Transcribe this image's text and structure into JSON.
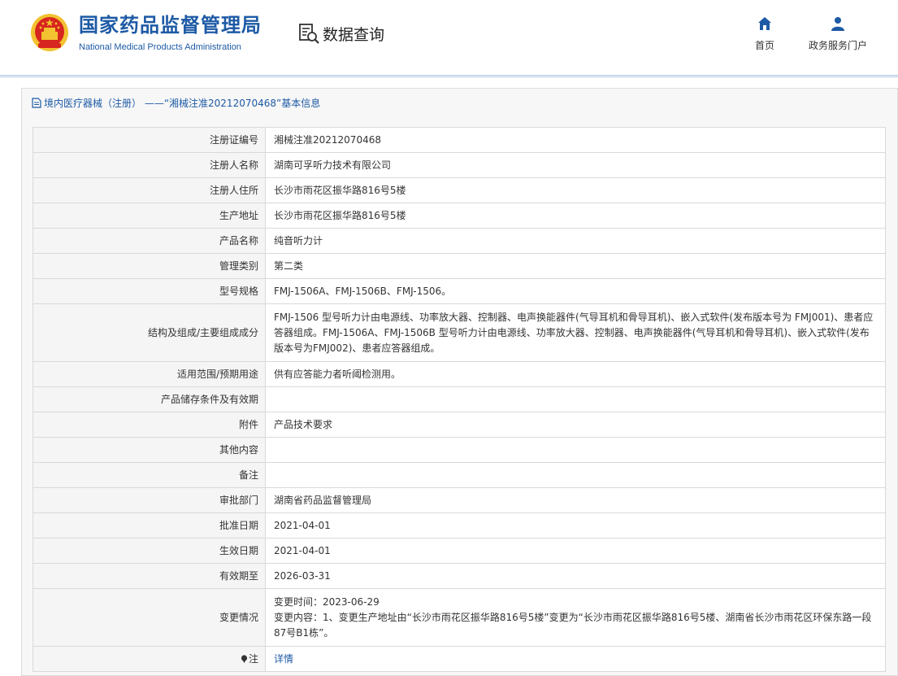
{
  "header": {
    "site_name_cn": "国家药品监督管理局",
    "site_name_en": "National Medical Products Administration",
    "section_title": "数据查询",
    "nav": [
      {
        "label": "首页",
        "icon": "home-icon"
      },
      {
        "label": "政务服务门户",
        "icon": "user-icon"
      }
    ]
  },
  "panel": {
    "title": "境内医疗器械（注册） ——“湘械注准20212070468”基本信息"
  },
  "rows": [
    {
      "key": "注册证编号",
      "value": "湘械注准20212070468"
    },
    {
      "key": "注册人名称",
      "value": "湖南可孚听力技术有限公司"
    },
    {
      "key": "注册人住所",
      "value": "长沙市雨花区振华路816号5楼"
    },
    {
      "key": "生产地址",
      "value": "长沙市雨花区振华路816号5楼"
    },
    {
      "key": "产品名称",
      "value": "纯音听力计"
    },
    {
      "key": "管理类别",
      "value": "第二类"
    },
    {
      "key": "型号规格",
      "value": "FMJ-1506A、FMJ-1506B、FMJ-1506。"
    },
    {
      "key": "结构及组成/主要组成成分",
      "value": "FMJ-1506 型号听力计由电源线、功率放大器、控制器、电声换能器件(气导耳机和骨导耳机)、嵌入式软件(发布版本号为 FMJ001)、患者应答器组成。FMJ-1506A、FMJ-1506B 型号听力计由电源线、功率放大器、控制器、电声换能器件(气导耳机和骨导耳机)、嵌入式软件(发布版本号为FMJ002)、患者应答器组成。"
    },
    {
      "key": "适用范围/预期用途",
      "value": "供有应答能力者听阈检测用。"
    },
    {
      "key": "产品储存条件及有效期",
      "value": ""
    },
    {
      "key": "附件",
      "value": "产品技术要求"
    },
    {
      "key": "其他内容",
      "value": ""
    },
    {
      "key": "备注",
      "value": ""
    },
    {
      "key": "审批部门",
      "value": "湖南省药品监督管理局"
    },
    {
      "key": "批准日期",
      "value": "2021-04-01"
    },
    {
      "key": "生效日期",
      "value": "2021-04-01"
    },
    {
      "key": "有效期至",
      "value": "2026-03-31"
    }
  ],
  "change": {
    "key": "变更情况",
    "time": "变更时间：2023-06-29",
    "content": "变更内容：1、变更生产地址由“长沙市雨花区振华路816号5楼”变更为“长沙市雨花区振华路816号5楼、湖南省长沙市雨花区环保东路一段87号B1栋”。"
  },
  "note": {
    "key": "注",
    "icon": "pin-icon",
    "link_label": "详情"
  },
  "colors": {
    "brand_blue": "#1d5aa5",
    "emblem_red": "#d7251f",
    "emblem_gold": "#f2c230"
  }
}
